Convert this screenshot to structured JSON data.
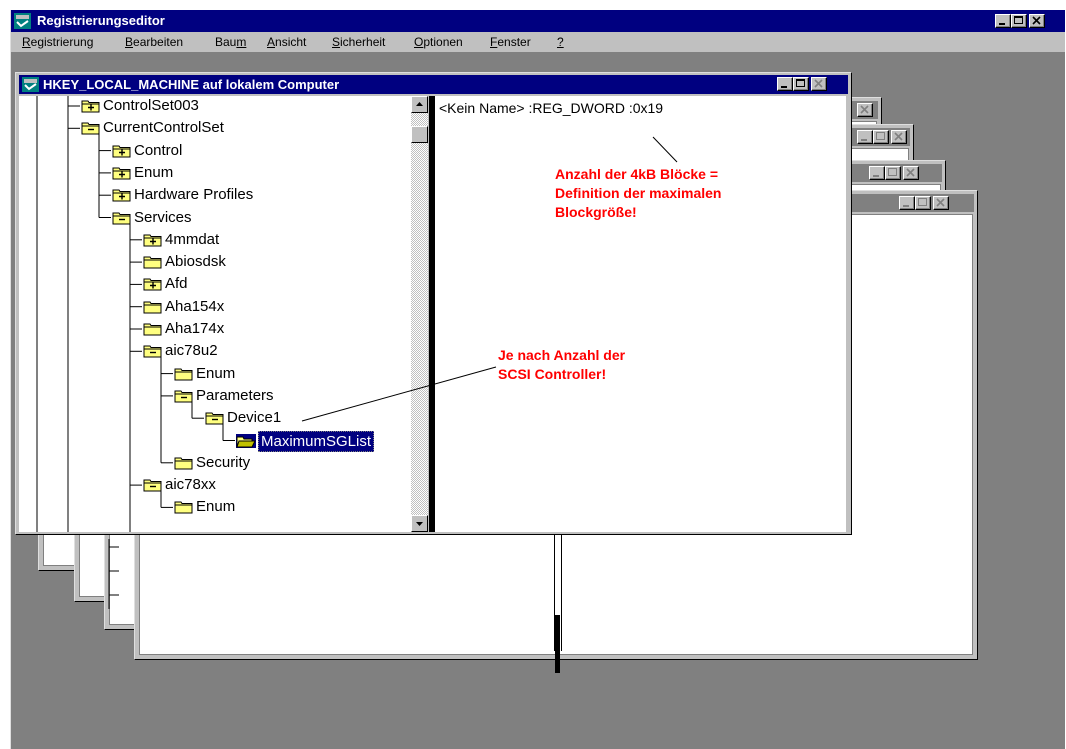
{
  "app": {
    "title": "Registrierungseditor"
  },
  "menu": [
    {
      "label": "Registrierung",
      "key": "R",
      "rest": "egistrierung"
    },
    {
      "label": "Bearbeiten",
      "key": "B",
      "rest": "earbeiten"
    },
    {
      "label": "Baum",
      "pre": "Bau",
      "key": "m",
      "rest": ""
    },
    {
      "label": "Ansicht",
      "key": "A",
      "rest": "nsicht"
    },
    {
      "label": "Sicherheit",
      "key": "S",
      "rest": "icherheit"
    },
    {
      "label": "Optionen",
      "key": "O",
      "rest": "ptionen"
    },
    {
      "label": "Fenster",
      "key": "F",
      "rest": "enster"
    },
    {
      "label": "?",
      "key": "?",
      "rest": ""
    }
  ],
  "window": {
    "title": "HKEY_LOCAL_MACHINE auf lokalem Computer"
  },
  "tree": [
    {
      "label": "ControlSet003",
      "state": "plus"
    },
    {
      "label": "CurrentControlSet",
      "state": "minus"
    },
    {
      "label": "Control",
      "state": "plus"
    },
    {
      "label": "Enum",
      "state": "plus"
    },
    {
      "label": "Hardware Profiles",
      "state": "plus"
    },
    {
      "label": "Services",
      "state": "minus"
    },
    {
      "label": "4mmdat",
      "state": "plus"
    },
    {
      "label": "Abiosdsk",
      "state": "none"
    },
    {
      "label": "Afd",
      "state": "plus"
    },
    {
      "label": "Aha154x",
      "state": "none"
    },
    {
      "label": "Aha174x",
      "state": "none"
    },
    {
      "label": "aic78u2",
      "state": "minus"
    },
    {
      "label": "Enum",
      "state": "none"
    },
    {
      "label": "Parameters",
      "state": "minus"
    },
    {
      "label": "Device1",
      "state": "minus"
    },
    {
      "label": "MaximumSGList",
      "state": "open",
      "selected": true
    },
    {
      "label": "Security",
      "state": "none"
    },
    {
      "label": "aic78xx",
      "state": "minus"
    },
    {
      "label": "Enum",
      "state": "none"
    }
  ],
  "values": {
    "entry": "<Kein Name> :REG_DWORD :0x19"
  },
  "annotations": {
    "blocks": [
      "Anzahl der 4kB Blöcke =",
      "Definition der maximalen",
      "Blockgröße!"
    ],
    "controller": [
      "Je nach Anzahl der",
      "SCSI Controller!"
    ]
  },
  "colors": {
    "titlebar": "#000080",
    "face": "#c0c0c0",
    "desktop": "#808080",
    "annotation": "#ff0000"
  }
}
